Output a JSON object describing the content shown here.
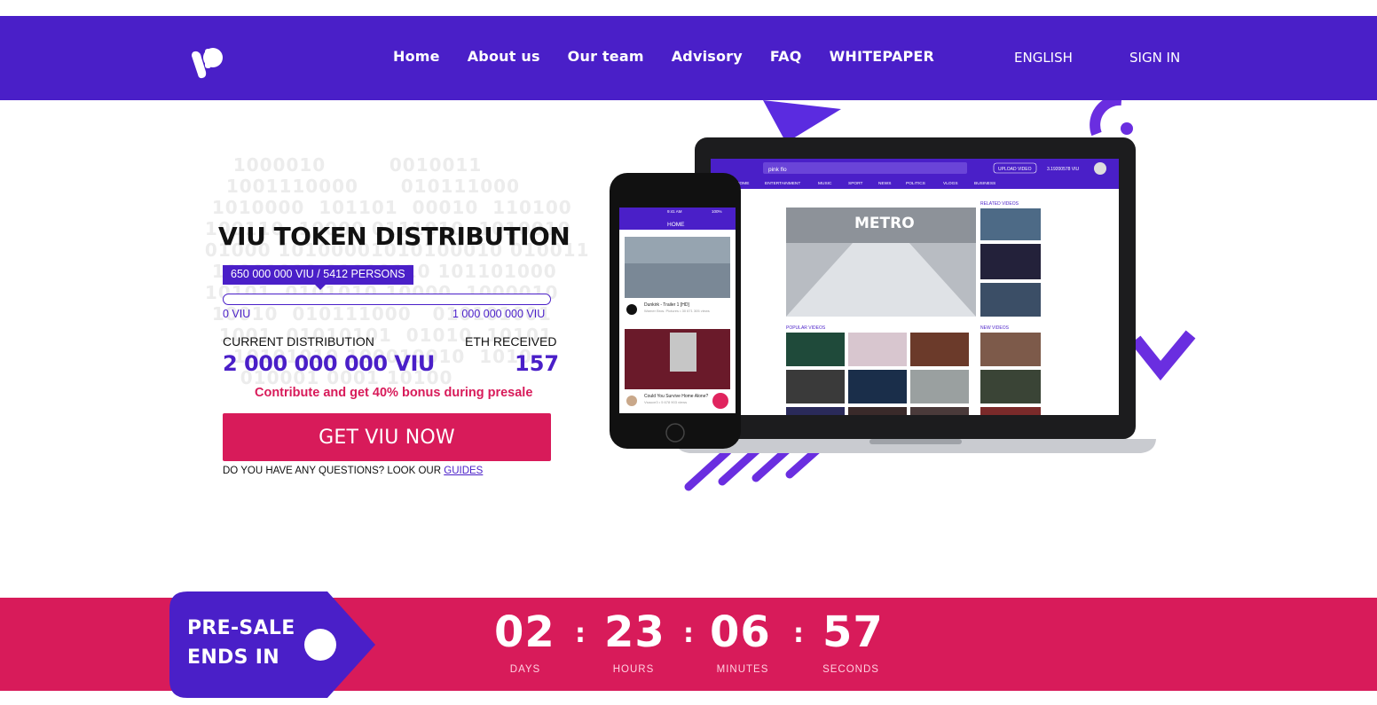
{
  "nav": {
    "links": [
      "Home",
      "About us",
      "Our team",
      "Advisory",
      "FAQ",
      "WHITEPAPER"
    ],
    "language": "ENGLISH",
    "sign_in": "SIGN IN"
  },
  "hero": {
    "title": "VIU TOKEN DISTRIBUTION",
    "progress_badge": "650 000 000 VIU / 5412 PERSONS",
    "progress_fraction": 0.0,
    "range_min": "0 VIU",
    "range_max": "1 000 000 000 VIU",
    "current_label": "CURRENT DISTRIBUTION",
    "current_value": "2 000 000 000 VIU",
    "eth_label": "ETH RECEIVED",
    "eth_value": "157",
    "bonus_text": "Contribute and get 40% bonus during presale",
    "cta_label": "GET VIU NOW",
    "questions_text": "DO YOU HAVE ANY QUESTIONS? LOOK OUR",
    "guides_link": "GUIDES"
  },
  "mockup": {
    "laptop_search": "pink flo",
    "laptop_upload": "UPLOAD VIDEO",
    "laptop_balance": "3.19200578 VIU",
    "laptop_categories": [
      "HOME",
      "ENTERTAINMENT",
      "MUSIC",
      "SPORT",
      "NEWS",
      "POLITICS",
      "VLOGS",
      "BUSINESS"
    ],
    "feature_title": "METRO",
    "related_label": "RELATED VIDEOS",
    "popular_label": "POPULAR VIDEOS",
    "new_label": "NEW VIDEOS",
    "phone_time": "9:41 AM",
    "phone_battery": "100%",
    "phone_home": "HOME",
    "phone_video1_title": "Dunkirk - Trailer 1 [HD]",
    "phone_video1_meta": "Warner Bros. Pictures  •  30 671 305 views",
    "phone_video2_title": "Could You Survive Home Alone?",
    "phone_video2_meta": "Vsauce3  •  5 678 903 views"
  },
  "countdown": {
    "tag_line1": "PRE-SALE",
    "tag_line2": "ENDS IN",
    "days": "02",
    "hours": "23",
    "minutes": "06",
    "seconds": "57",
    "days_label": "DAYS",
    "hours_label": "HOURS",
    "minutes_label": "MINUTES",
    "seconds_label": "SECONDS",
    "separator": ":"
  },
  "colors": {
    "brand_purple": "#4a1fc8",
    "accent_pink": "#d81b5a"
  }
}
